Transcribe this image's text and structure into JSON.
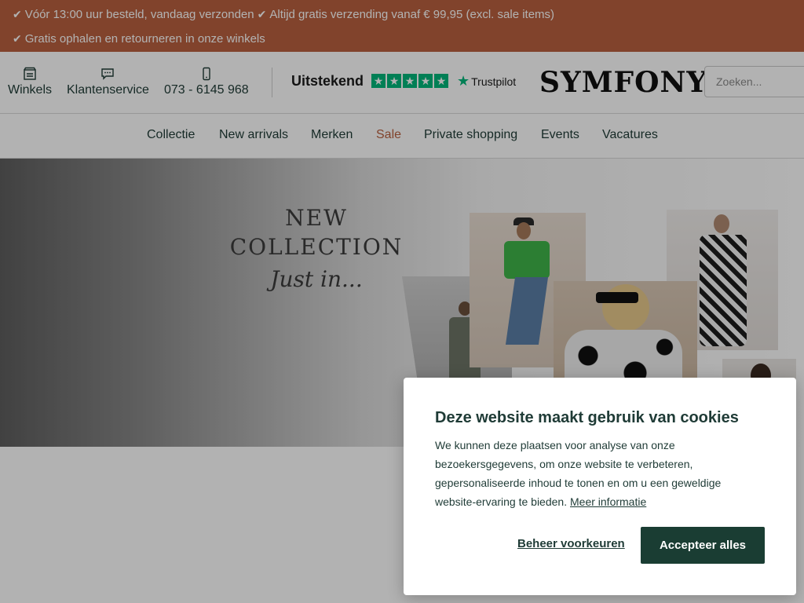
{
  "promo": {
    "items": [
      "Vóór 13:00 uur besteld, vandaag verzonden",
      "Altijd gratis verzending vanaf € 99,95 (excl. sale items)",
      "Gratis ophalen en retourneren in onze winkels"
    ],
    "icon": "check-icon"
  },
  "header": {
    "winkels": "Winkels",
    "klantenservice": "Klantenservice",
    "phone": "073 - 6145 968",
    "trustpilot_rating": "Uitstekend",
    "trustpilot_brand": "Trustpilot",
    "logo": "SYMFONY",
    "search_placeholder": "Zoeken...",
    "icons": [
      "store-icon",
      "chat-icon",
      "phone-icon",
      "trustpilot-star-icon"
    ]
  },
  "nav": {
    "items": [
      "Collectie",
      "New arrivals",
      "Merken",
      "Sale",
      "Private shopping",
      "Events",
      "Vacatures"
    ],
    "highlight_color": "#b9613f"
  },
  "hero": {
    "line1": "NEW",
    "line2": "COLLECTION",
    "line3": "Just in..."
  },
  "cookie": {
    "title": "Deze website maakt gebruik van cookies",
    "text": "We kunnen deze plaatsen voor analyse van onze bezoekersgegevens, om onze website te verbeteren, gepersonaliseerde inhoud te tonen en om u een geweldige website-ervaring te bieden.",
    "more_link": "Meer informatie",
    "manage_label": "Beheer voorkeuren",
    "accept_label": "Accepteer alles"
  },
  "colors": {
    "promo_bg": "#b9613f",
    "accent_dark": "#1a3d33",
    "trustpilot_green": "#00b67a"
  }
}
